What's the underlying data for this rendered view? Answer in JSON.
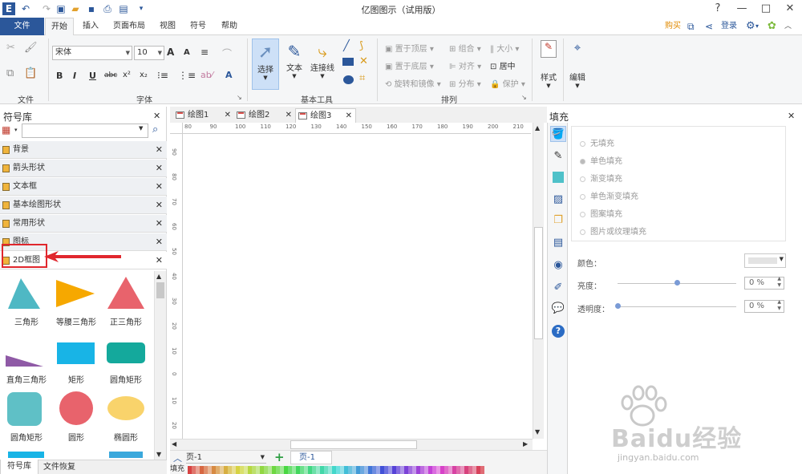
{
  "app": {
    "title": "亿图图示（试用版）",
    "window_controls": [
      "?",
      "—",
      "□",
      "✕"
    ]
  },
  "ribbon": {
    "file_tab": "文件",
    "tabs": [
      "开始",
      "插入",
      "页面布局",
      "视图",
      "符号",
      "帮助"
    ],
    "active_tab": "开始",
    "right": {
      "buy": "购买",
      "login": "登录"
    },
    "groups": {
      "file_label": "文件",
      "font_label": "字体",
      "basic_tools_label": "基本工具",
      "arrange_label": "排列"
    },
    "font": {
      "family": "宋体",
      "size": "10"
    },
    "font_buttons": {
      "grow": "A",
      "shrink": "A",
      "bold": "B",
      "italic": "I",
      "underline": "U",
      "strike": "abc",
      "sup": "x²",
      "sub": "x₂",
      "color": "A"
    },
    "tools": {
      "select": "选择",
      "text": "文本",
      "connector": "连接线"
    },
    "arrange": {
      "bring_front": "置于顶层",
      "send_back": "置于底层",
      "rotate": "旋转和镜像",
      "group": "组合",
      "align": "对齐",
      "distribute": "分布",
      "size": "大小",
      "center": "居中",
      "protect": "保护"
    },
    "style": "样式",
    "edit": "编辑"
  },
  "symbol_library": {
    "title": "符号库",
    "search_placeholder": "",
    "categories": [
      "背景",
      "箭头形状",
      "文本框",
      "基本绘图形状",
      "常用形状",
      "图标",
      "2D框图"
    ],
    "highlighted_category": "2D框图",
    "shapes": [
      {
        "label": "三角形",
        "icon": "triangle-icon",
        "color": "#4fb8c4"
      },
      {
        "label": "等腰三角形",
        "icon": "isosceles-triangle-icon",
        "color": "#f6a800"
      },
      {
        "label": "正三角形",
        "icon": "equilateral-triangle-icon",
        "color": "#e8636c"
      },
      {
        "label": "直角三角形",
        "icon": "right-triangle-icon",
        "color": "#8f5aa6"
      },
      {
        "label": "矩形",
        "icon": "rectangle-icon",
        "color": "#18b4e6"
      },
      {
        "label": "圆角矩形",
        "icon": "rounded-rectangle-icon",
        "color": "#14a99c"
      },
      {
        "label": "圆角矩形",
        "icon": "rounded-square-icon",
        "color": "#5fc0c6"
      },
      {
        "label": "圆形",
        "icon": "circle-icon",
        "color": "#e8636c"
      },
      {
        "label": "椭圆形",
        "icon": "ellipse-icon",
        "color": "#f9d36b"
      }
    ]
  },
  "bottom_tabs": [
    "符号库",
    "文件恢复"
  ],
  "documents": {
    "tabs": [
      "绘图1",
      "绘图2",
      "绘图3"
    ],
    "active": "绘图3"
  },
  "rulers": {
    "horizontal": [
      "80",
      "90",
      "100",
      "110",
      "120",
      "130",
      "140",
      "150",
      "160",
      "170",
      "180",
      "190",
      "200",
      "210"
    ],
    "vertical": [
      "90",
      "80",
      "70",
      "60",
      "50",
      "40",
      "30",
      "20",
      "10",
      "0",
      "10",
      "20",
      "30"
    ]
  },
  "pages": {
    "current": "页-1",
    "tab": "页-1",
    "fill_label": "填充"
  },
  "fill_panel": {
    "title": "填充",
    "options": [
      "无填充",
      "单色填充",
      "渐变填充",
      "单色渐变填充",
      "图案填充",
      "图片或纹理填充"
    ],
    "color_label": "颜色：",
    "brightness_label": "亮度：",
    "brightness_value": "0 %",
    "brightness_level": 0.5,
    "transparency_label": "透明度：",
    "transparency_value": "0 %",
    "transparency_level": 0
  },
  "side_icons": [
    "fill-icon",
    "line-icon",
    "shadow-icon",
    "image-icon",
    "layer-icon",
    "page-icon",
    "globe-icon",
    "note-icon",
    "comment-icon",
    "help-icon"
  ],
  "watermark": {
    "text": "Baidu经验",
    "url_text": "jingyan.baidu.com"
  }
}
